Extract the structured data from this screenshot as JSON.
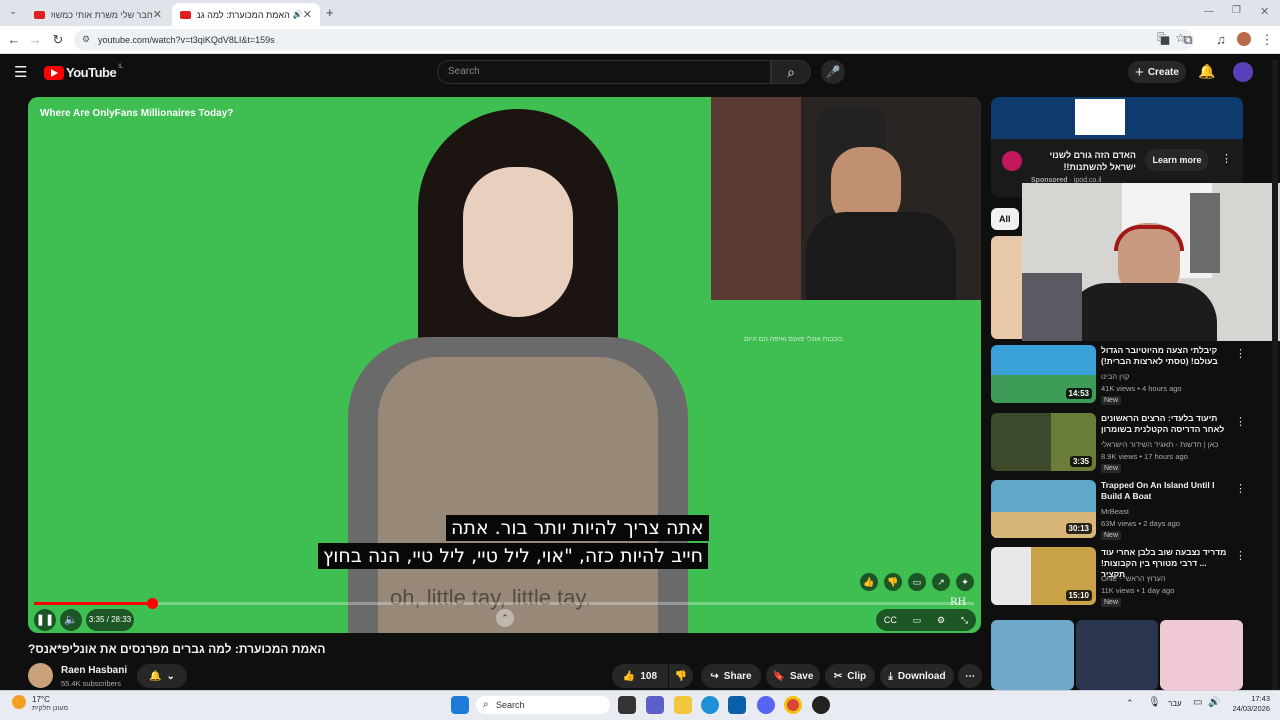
{
  "browser": {
    "tabs": [
      {
        "label": "חבר שלי משרת אותי כמשוק יום",
        "active": false
      },
      {
        "label": "האמת המכוערת: למה גברי",
        "active": true
      }
    ],
    "new_tab": "+",
    "url": "youtube.com/watch?v=t3qiKQdV8LI&t=159s"
  },
  "youtube": {
    "logo": "YouTube",
    "logo_region": "IL",
    "search_placeholder": "Search",
    "create_label": "Create"
  },
  "video": {
    "overlay_title": "Where Are OnlyFans Millionaires Today?",
    "subtitle_line1": "אתה צריך להיות יותר בור.  אתה",
    "subtitle_line2": "חייב להיות כזה, \"אוי, ליל טיי, ליל טיי, הנה בחוץ",
    "subtitle_en": "oh, little tay, little tay.",
    "watermark_side": "כוכבות אונלי פאנס ואיפה הם היום",
    "time": "3:35 / 28:33",
    "progress_fraction": 0.126,
    "title": "האמת המכוערת: למה גברים מפרנסים את אונליפ*אנס?",
    "channel": "Raen Hasbani",
    "subscribers": "55.4K subscribers",
    "likes": "108",
    "share": "Share",
    "save": "Save",
    "clip": "Clip",
    "download": "Download"
  },
  "sidebar": {
    "ad": {
      "title": "האדם הזה גורם לשנוי ישראל להשתנות!!",
      "sponsored": "Sponsored",
      "domain": "ipod.co.il",
      "cta": "Learn more"
    },
    "chip_all": "All",
    "items": [
      {
        "title": "קיבלתי הצעה מהיוטיובר הגדול בעולם! (טסתי לארצות הברית!)",
        "channel": "קוין הבינו",
        "meta": "41K views • 4 hours ago",
        "badge": "New",
        "duration": "14:53",
        "color": "#3aa0d8"
      },
      {
        "title": "תיעוד בלעדי: הרצים הראשונים לאחר הדריסה הקטלנית בשומרון",
        "channel": "כאן | חדשות - תאגיד השידור הישראלי",
        "meta": "8.9K views • 17 hours ago",
        "badge": "New",
        "duration": "3:35",
        "color": "#3e4a2c"
      },
      {
        "title": "Trapped On An Island Until I Build A Boat",
        "channel": "MrBeast",
        "meta": "63M views • 2 days ago",
        "badge": "New",
        "duration": "30:13",
        "color": "#5fa8c8"
      },
      {
        "title": "מדריד נצבעה שוב בלבן אחרי עוד ... דרבי מטורף בין הקבוצות! תקציר",
        "channel": "ONE - הערוץ הראשי",
        "meta": "11K views • 1 day ago",
        "badge": "New",
        "duration": "15:10",
        "color": "#c9a247"
      }
    ]
  },
  "taskbar": {
    "weather_temp": "17°C",
    "weather_desc": "מעונן חלקית",
    "search": "Search",
    "lang": "עבר",
    "time": "17:43",
    "date": "24/03/2026"
  },
  "colors": {
    "yt_red": "#ff0000",
    "green_screen": "#3fbf52"
  }
}
